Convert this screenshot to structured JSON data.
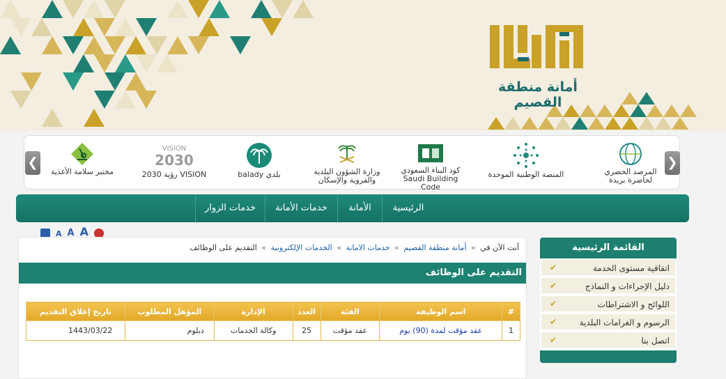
{
  "header": {
    "logo_text": "أمانة منطقة القصيم"
  },
  "partners": [
    {
      "name": "partner-urban-observatory",
      "caption": "المرصد الحضري لحاضرة بريدة"
    },
    {
      "name": "partner-unified-platform",
      "caption": "المنصة الوطنية الموحدة"
    },
    {
      "name": "partner-building-code",
      "caption": "كود البناء السعودي Saudi Building Code"
    },
    {
      "name": "partner-ministry",
      "caption": "وزارة الشؤون البلدية والقروية والإسكان"
    },
    {
      "name": "partner-balady",
      "caption": "بلدي balady"
    },
    {
      "name": "partner-vision2030",
      "caption": "VISION رؤية 2030"
    },
    {
      "name": "partner-food-lab",
      "caption": "مختبر سلامة الأغذية"
    }
  ],
  "nav": {
    "items": [
      "الرئيسية",
      "الأمانة",
      "خدمات الأمانة",
      "خدمات الزوار"
    ]
  },
  "tools": {
    "a_small": "A",
    "a_medium": "A",
    "a_large": "A"
  },
  "breadcrumb": {
    "prefix": "أنت الآن في",
    "items": [
      "أمانة منطقة القصيم",
      "خدمات الامانة",
      "الخدمات الإلكترونية",
      "التقديم على الوظائف"
    ]
  },
  "page_title": "التقديم على الوظائف",
  "table": {
    "headers": [
      "#",
      "اسم الوظيفة",
      "الفئة",
      "العدد",
      "الإدارة",
      "المؤهل المطلوب",
      "تاريخ إغلاق التقديم"
    ],
    "rows": [
      [
        "1",
        "عقد مؤقت لمدة (90) يوم",
        "عقد مؤقت",
        "25",
        "وكالة الخدمات",
        "دبلوم",
        "1443/03/22"
      ]
    ]
  },
  "sidebar": {
    "title": "القائمة الرئيسية",
    "items": [
      "اتفاقية مستوى الخدمة",
      "دليل الإجراءات و النماذج",
      "اللوائح و الاشتراطات",
      "الرسوم و الغرامات البلدية",
      "اتصل بنا"
    ]
  },
  "colors": {
    "primary_teal": "#1d8272",
    "gold": "#e2a928",
    "link_blue": "#1c5fa8"
  }
}
